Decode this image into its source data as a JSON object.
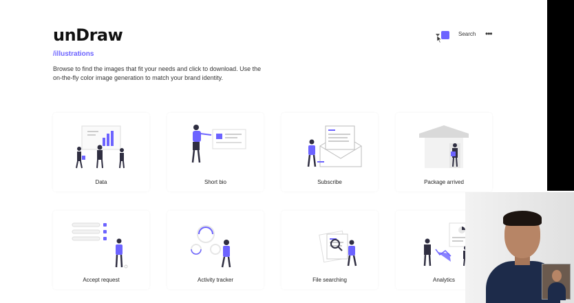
{
  "header": {
    "logo": "unDraw",
    "subtitle": "/illustrations",
    "intro": "Browse to find the images that fit your needs and click to download. Use the on-the-fly color image generation to match your brand identity.",
    "search_label": "Search",
    "more_label": "•••",
    "accent_color": "#6c63ff"
  },
  "cards": [
    {
      "label": "Data",
      "icon": "data-illustration"
    },
    {
      "label": "Short bio",
      "icon": "short-bio-illustration"
    },
    {
      "label": "Subscribe",
      "icon": "subscribe-illustration"
    },
    {
      "label": "Package arrived",
      "icon": "package-arrived-illustration"
    },
    {
      "label": "Accept request",
      "icon": "accept-request-illustration"
    },
    {
      "label": "Activity tracker",
      "icon": "activity-tracker-illustration"
    },
    {
      "label": "File searching",
      "icon": "file-searching-illustration"
    },
    {
      "label": "Analytics",
      "icon": "analytics-illustration"
    }
  ],
  "colors": {
    "accent": "#6c63ff",
    "text": "#222222",
    "background": "#ffffff"
  }
}
